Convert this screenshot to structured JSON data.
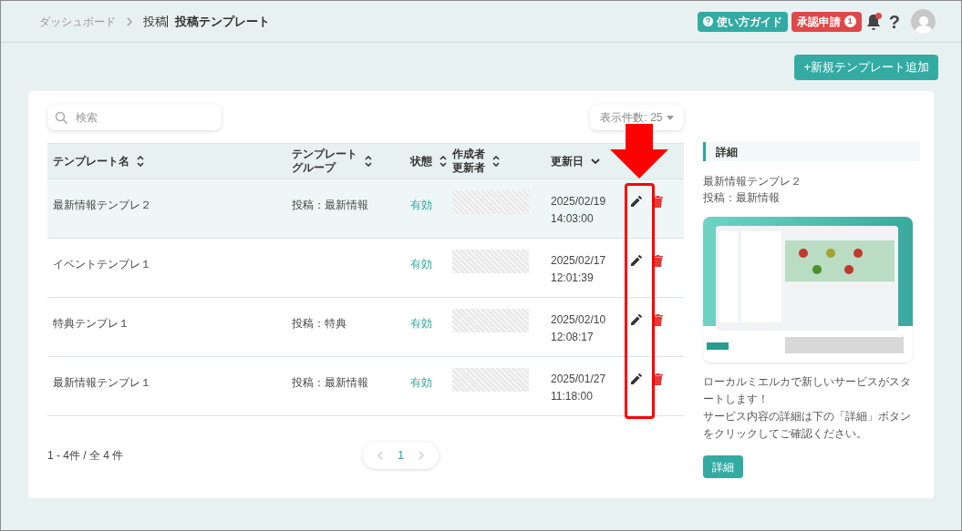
{
  "breadcrumbs": [
    {
      "label": "ダッシュボード",
      "kind": "link"
    },
    {
      "label": "投稿",
      "kind": "parent"
    },
    {
      "label": "投稿テンプレート",
      "kind": "current"
    }
  ],
  "header": {
    "guide_button": "使い方ガイド",
    "approval_button": {
      "label": "承認申請",
      "count": "1"
    },
    "notifications": {
      "unread": true
    },
    "help": "?"
  },
  "add_button": "+新規テンプレート追加",
  "search": {
    "placeholder": "検索"
  },
  "page_size": {
    "label": "表示件数: 25"
  },
  "table": {
    "columns": [
      {
        "lines": [
          "テンプレート名"
        ],
        "sorted": false
      },
      {
        "lines": [
          "テンプレート",
          "グループ"
        ],
        "sorted": false
      },
      {
        "lines": [
          "状態"
        ],
        "sorted": false
      },
      {
        "lines": [
          "作成者",
          "更新者"
        ],
        "sorted": false
      },
      {
        "lines": [
          "更新日"
        ],
        "sorted": true
      }
    ],
    "rows": [
      {
        "name": "最新情報テンプレ２",
        "group": "投稿：最新情報",
        "status": "有効",
        "date": "2025/02/19",
        "time": "14:03:00",
        "selected": true
      },
      {
        "name": "イベントテンプレ１",
        "status": "有効",
        "date": "2025/02/17",
        "time": "12:01:39",
        "selected": false
      },
      {
        "name": "特典テンプレ１",
        "group": "投稿：特典",
        "status": "有効",
        "date": "2025/02/10",
        "time": "12:08:17",
        "selected": false
      },
      {
        "name": "最新情報テンプレ１",
        "group": "投稿：最新情報",
        "status": "有効",
        "date": "2025/01/27",
        "time": "11:18:00",
        "selected": false
      }
    ]
  },
  "footer": {
    "count": "1 - 4件 / 全 4 件",
    "pages": [
      {
        "label": "1",
        "selected": true
      }
    ]
  },
  "detail": {
    "heading": "詳細",
    "name": "最新情報テンプレ２",
    "group": "投稿：最新情報",
    "image": {
      "kind": "picture"
    },
    "body": [
      "ローカルミエルカで新しいサービスがスタートします！",
      "サービス内容の詳細は下の「詳細」ボタンをクリックしてご確認ください。"
    ],
    "button": "詳細"
  }
}
